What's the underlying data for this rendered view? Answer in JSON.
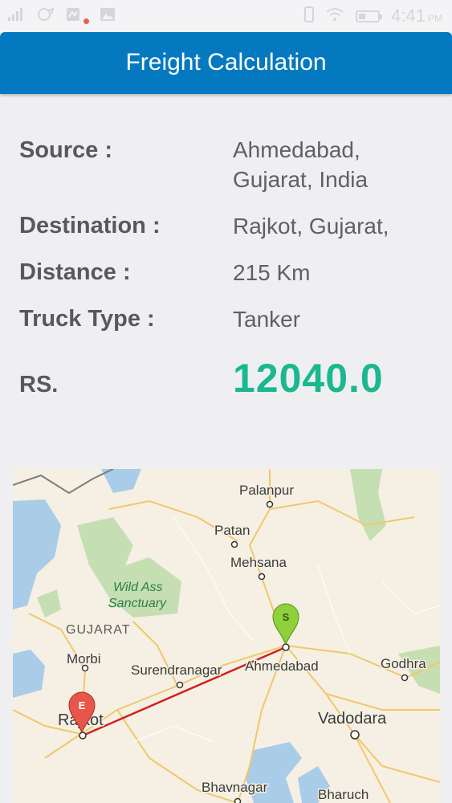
{
  "status_bar": {
    "time": "4:41",
    "ampm": "PM",
    "icons": [
      "signal-icon",
      "sync-icon",
      "notification-icon",
      "image-icon",
      "phone-icon",
      "wifi-icon",
      "battery-icon"
    ]
  },
  "app_bar": {
    "title": "Freight Calculation"
  },
  "details": {
    "source_label": "Source :",
    "source_value_line1": "Ahmedabad,",
    "source_value_line2": "Gujarat, India",
    "destination_label": "Destination :",
    "destination_value": "Rajkot, Gujarat,",
    "distance_label": "Distance :",
    "distance_value": "215 Km",
    "truck_type_label": "Truck Type :",
    "truck_type_value": "Tanker",
    "price_label": "RS.",
    "price_value": "12040.0"
  },
  "map": {
    "cities": {
      "palanpur": "Palanpur",
      "patan": "Patan",
      "mehsana": "Mehsana",
      "ahmedabad": "Ahmedabad",
      "godhra": "Godhra",
      "morbi": "Morbi",
      "surendranagar": "Surendranagar",
      "rajkot": "Rajkot",
      "vadodara": "Vadodara",
      "bhavnagar": "Bhavnagar",
      "bharuch": "Bharuch"
    },
    "region_label": "GUJARAT",
    "park_label_line1": "Wild Ass",
    "park_label_line2": "Sanctuary",
    "start_marker_letter": "S",
    "end_marker_letter": "E",
    "colors": {
      "route": "#d32020",
      "start_marker": "#8fd13a",
      "end_marker": "#e8554a",
      "water": "#a9cce8",
      "park": "#c5dfb3",
      "road": "#f0c86a"
    }
  }
}
